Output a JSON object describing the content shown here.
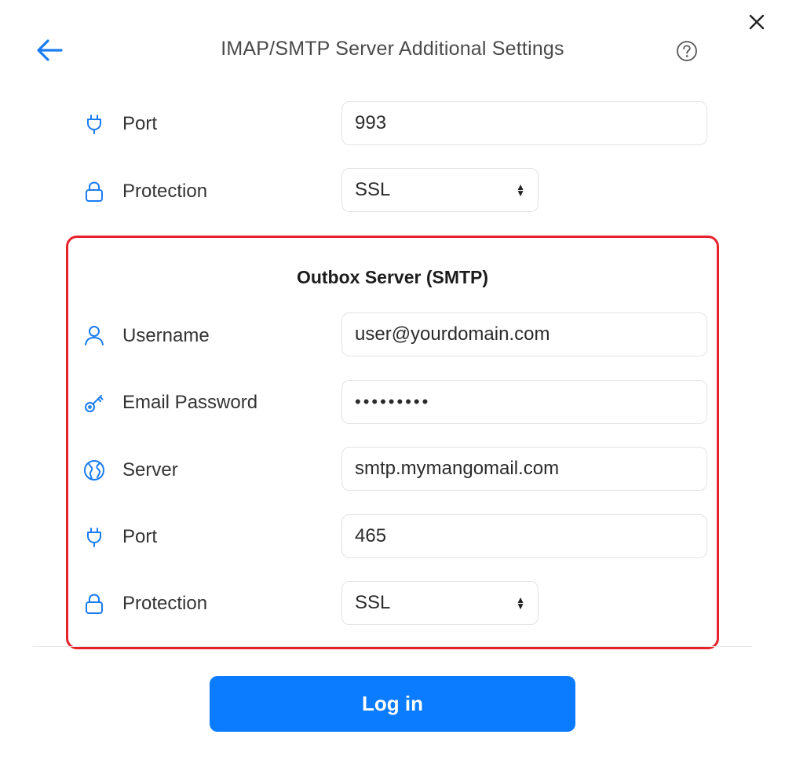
{
  "header": {
    "title": "IMAP/SMTP Server Additional Settings",
    "back_icon": "arrow-left-icon",
    "help_icon": "question-circle-icon",
    "close_icon": "close-icon"
  },
  "incoming": {
    "port": {
      "label": "Port",
      "value": "993",
      "icon": "plug-icon"
    },
    "protection": {
      "label": "Protection",
      "value": "SSL",
      "icon": "lock-icon"
    }
  },
  "outgoing": {
    "title": "Outbox Server (SMTP)",
    "username": {
      "label": "Username",
      "value": "user@yourdomain.com",
      "icon": "user-icon"
    },
    "password": {
      "label": "Email Password",
      "value": "•••••••••",
      "icon": "key-icon"
    },
    "server": {
      "label": "Server",
      "value": "smtp.mymangomail.com",
      "icon": "globe-icon"
    },
    "port": {
      "label": "Port",
      "value": "465",
      "icon": "plug-icon"
    },
    "protection": {
      "label": "Protection",
      "value": "SSL",
      "icon": "lock-icon"
    }
  },
  "actions": {
    "login_label": "Log in"
  },
  "colors": {
    "accent": "#0b7cff",
    "highlight": "#e8222a"
  }
}
